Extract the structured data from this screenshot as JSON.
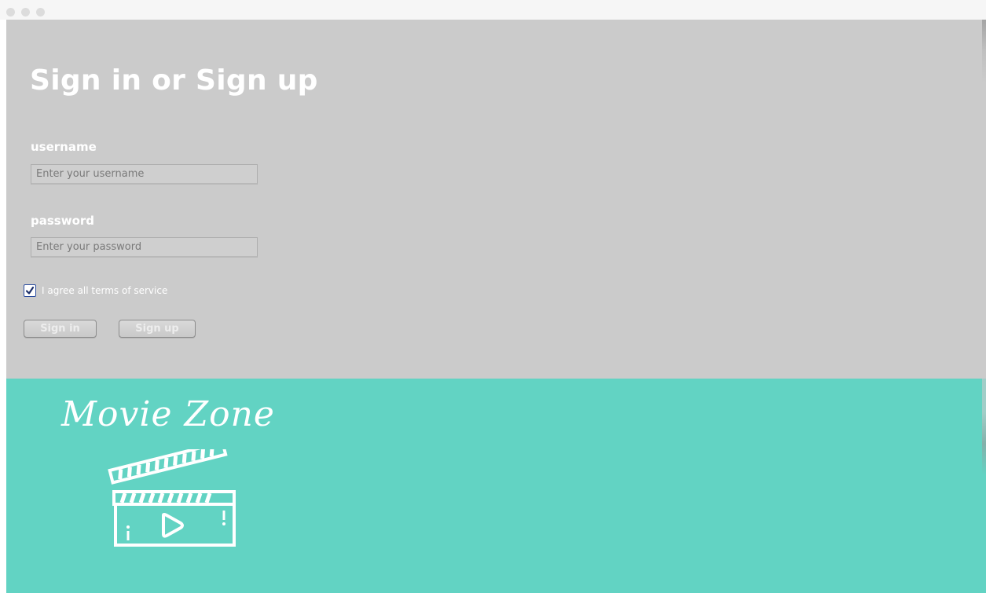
{
  "window": {
    "traffic_lights": [
      "close",
      "minimize",
      "zoom"
    ]
  },
  "login": {
    "heading": "Sign in or Sign up",
    "username_label": "username",
    "username_placeholder": "Enter your username",
    "password_label": "password",
    "password_placeholder": "Enter your password",
    "terms_label": "I agree all terms of service",
    "terms_checked": true,
    "sign_in_label": "Sign in",
    "sign_up_label": "Sign up"
  },
  "brand": {
    "name": "Movie Zone",
    "icon": "clapperboard-play-icon"
  },
  "colors": {
    "top_panel": "#cbcbcb",
    "bottom_panel": "#62d3c3",
    "text": "#ffffff",
    "checkbox_accent": "#2a4c9e"
  }
}
